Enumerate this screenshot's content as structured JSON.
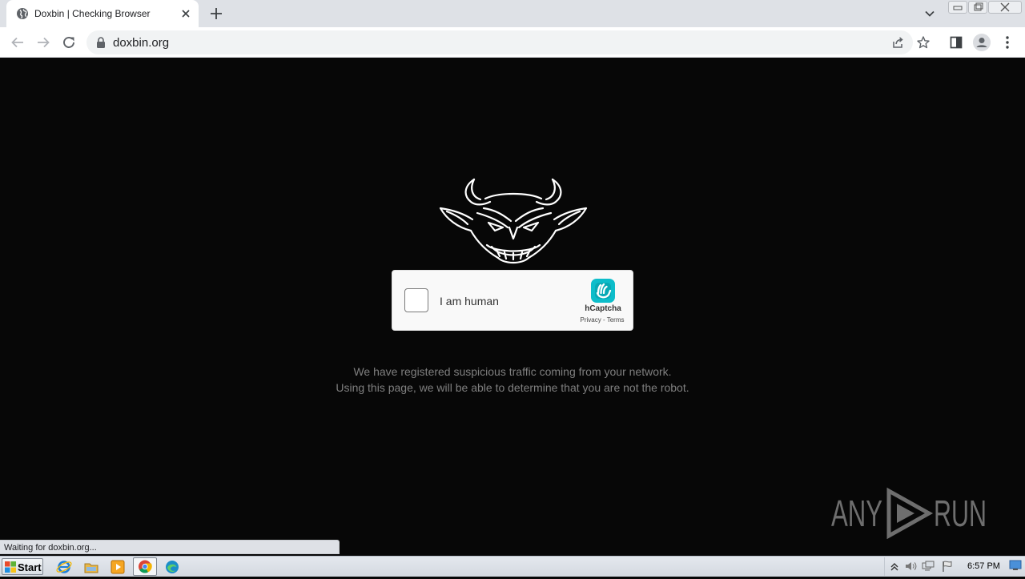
{
  "browser": {
    "tab": {
      "title": "Doxbin | Checking Browser"
    },
    "address_bar": {
      "url": "doxbin.org"
    }
  },
  "captcha": {
    "checkbox_label": "I am human",
    "brand": "hCaptcha",
    "privacy_link": "Privacy",
    "separator": "-",
    "terms_link": "Terms"
  },
  "page": {
    "message_line1": "We have registered suspicious traffic coming from your network.",
    "message_line2": "Using this page, we will be able to determine that you are not the robot.",
    "status_text": "Waiting for doxbin.org...",
    "watermark_text": "ANY RUN"
  },
  "taskbar": {
    "start_label": "Start",
    "clock": "6:57 PM"
  },
  "colors": {
    "page_background": "#070707",
    "tabstrip": "#dee1e6",
    "omnibox": "#f1f3f4",
    "message_text": "#7f7f7f",
    "hcaptcha_teal": "#0dbdca"
  },
  "icons": {
    "tab_favicon": "globe-icon",
    "tab_close": "close-icon",
    "new_tab": "plus-icon",
    "tab_search": "chevron-down-icon",
    "back": "arrow-left-icon",
    "forward": "arrow-right-icon",
    "reload": "reload-icon",
    "lock": "lock-icon",
    "share": "share-icon",
    "bookmark": "star-icon",
    "side_panel": "side-panel-icon",
    "profile": "profile-icon",
    "menu": "kebab-menu-icon"
  }
}
